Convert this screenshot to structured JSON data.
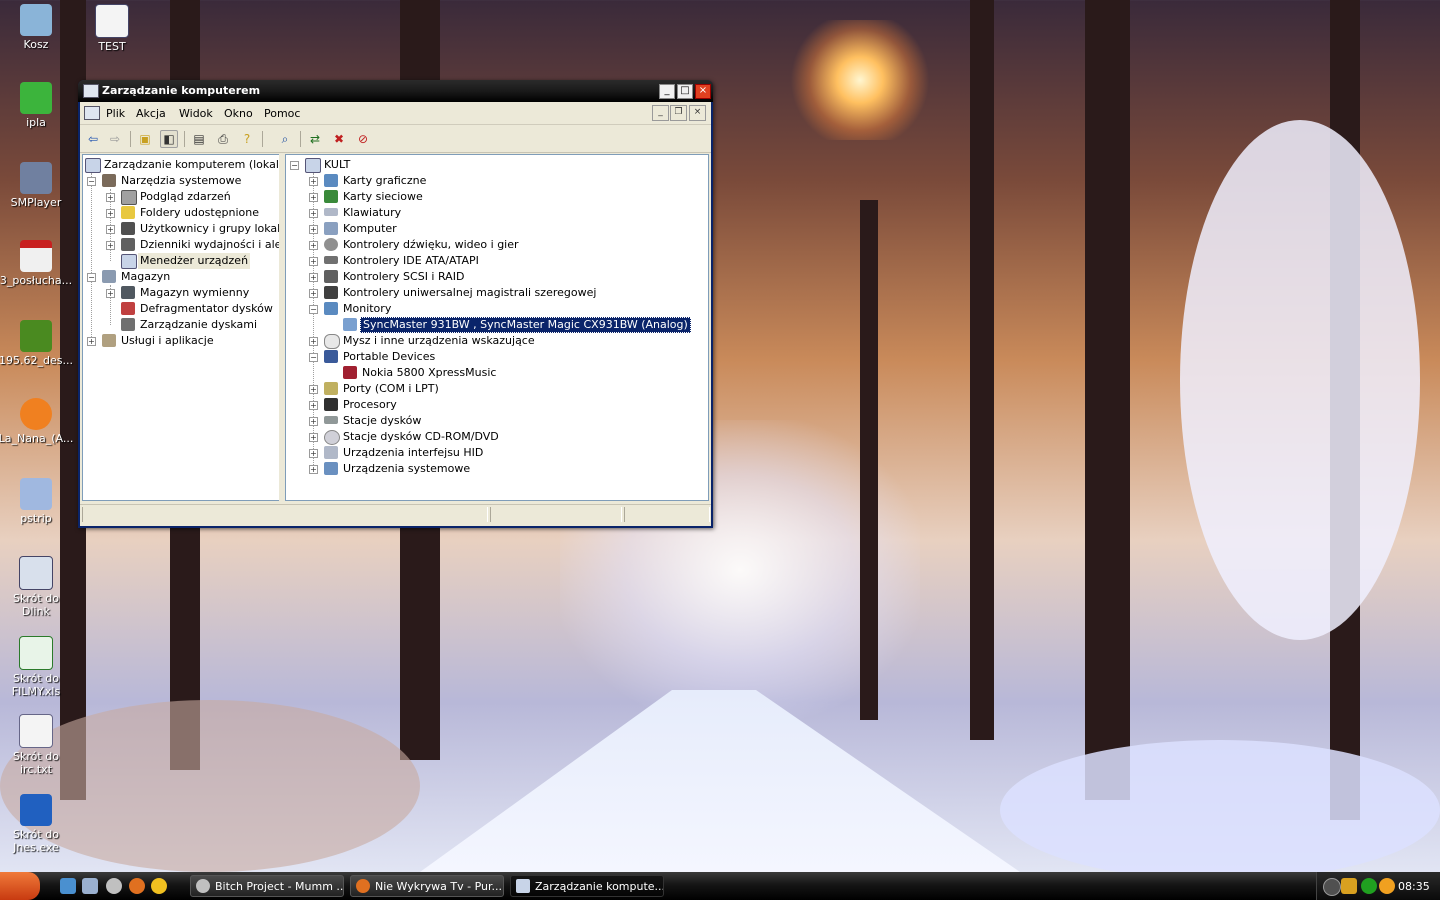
{
  "desktop": {
    "icons": [
      {
        "label": "Kosz",
        "icon": "recycle-bin-icon"
      },
      {
        "label": "TEST",
        "icon": "word-document-icon"
      },
      {
        "label": "ipla",
        "icon": "ipla-icon"
      },
      {
        "label": "SMPlayer",
        "icon": "smplayer-icon"
      },
      {
        "label": "3_posłucha...",
        "icon": "pdf-icon"
      },
      {
        "label": "195.62_des...",
        "icon": "nvidia-icon"
      },
      {
        "label": "La_Nana_(A...",
        "icon": "audio-file-icon"
      },
      {
        "label": "pstrip",
        "icon": "pstrip-icon"
      },
      {
        "label": "Skrót do Dlink",
        "icon": "network-shortcut-icon"
      },
      {
        "label": "Skrót do FILMY.xls",
        "icon": "excel-shortcut-icon"
      },
      {
        "label": "Skrót do irc.txt",
        "icon": "text-shortcut-icon"
      },
      {
        "label": "Skrót do Jnes.exe",
        "icon": "jnes-shortcut-icon"
      }
    ]
  },
  "window": {
    "title": "Zarządzanie komputerem",
    "menu": [
      "Plik",
      "Akcja",
      "Widok",
      "Okno",
      "Pomoc"
    ],
    "title_buttons": {
      "minimize": "_",
      "maximize": "□",
      "close": "×"
    },
    "mdi_buttons": {
      "minimize": "_",
      "restore": "❐",
      "close": "×"
    },
    "toolbar": [
      "back-icon",
      "forward-icon",
      "up-folder-icon",
      "show-hide-tree-icon",
      "properties-icon",
      "print-icon",
      "help-icon",
      "scan-hardware-icon",
      "update-driver-icon",
      "uninstall-icon",
      "disable-icon"
    ],
    "left_tree": [
      {
        "label": "Zarządzanie komputerem (lokalne)",
        "level": 0,
        "expander": "",
        "icon": "computer-management-icon"
      },
      {
        "label": "Narzędzia systemowe",
        "level": 1,
        "expander": "−",
        "icon": "system-tools-icon"
      },
      {
        "label": "Podgląd zdarzeń",
        "level": 2,
        "expander": "+",
        "icon": "event-viewer-icon"
      },
      {
        "label": "Foldery udostępnione",
        "level": 2,
        "expander": "+",
        "icon": "shared-folders-icon"
      },
      {
        "label": "Użytkownicy i grupy lokalne",
        "level": 2,
        "expander": "+",
        "icon": "users-groups-icon"
      },
      {
        "label": "Dzienniki wydajności i alerty",
        "level": 2,
        "expander": "+",
        "icon": "performance-logs-icon"
      },
      {
        "label": "Menedżer urządzeń",
        "level": 2,
        "expander": "",
        "icon": "device-manager-icon",
        "state": "inactive-selected"
      },
      {
        "label": "Magazyn",
        "level": 1,
        "expander": "−",
        "icon": "storage-icon"
      },
      {
        "label": "Magazyn wymienny",
        "level": 2,
        "expander": "+",
        "icon": "removable-storage-icon"
      },
      {
        "label": "Defragmentator dysków",
        "level": 2,
        "expander": "",
        "icon": "defragmenter-icon"
      },
      {
        "label": "Zarządzanie dyskami",
        "level": 2,
        "expander": "",
        "icon": "disk-management-icon"
      },
      {
        "label": "Usługi i aplikacje",
        "level": 1,
        "expander": "+",
        "icon": "services-applications-icon"
      }
    ],
    "right_tree": [
      {
        "label": "KULT",
        "level": 0,
        "expander": "−",
        "icon": "computer-icon"
      },
      {
        "label": "Karty graficzne",
        "level": 1,
        "expander": "+",
        "icon": "display-adapter-icon"
      },
      {
        "label": "Karty sieciowe",
        "level": 1,
        "expander": "+",
        "icon": "network-adapter-icon"
      },
      {
        "label": "Klawiatury",
        "level": 1,
        "expander": "+",
        "icon": "keyboard-icon"
      },
      {
        "label": "Komputer",
        "level": 1,
        "expander": "+",
        "icon": "computer-icon"
      },
      {
        "label": "Kontrolery dźwięku, wideo i gier",
        "level": 1,
        "expander": "+",
        "icon": "sound-controller-icon"
      },
      {
        "label": "Kontrolery IDE ATA/ATAPI",
        "level": 1,
        "expander": "+",
        "icon": "ide-controller-icon"
      },
      {
        "label": "Kontrolery SCSI i RAID",
        "level": 1,
        "expander": "+",
        "icon": "scsi-controller-icon"
      },
      {
        "label": "Kontrolery uniwersalnej magistrali szeregowej",
        "level": 1,
        "expander": "+",
        "icon": "usb-controller-icon"
      },
      {
        "label": "Monitory",
        "level": 1,
        "expander": "−",
        "icon": "monitor-icon"
      },
      {
        "label": "SyncMaster 931BW , SyncMaster Magic CX931BW (Analog)",
        "level": 2,
        "expander": "",
        "icon": "monitor-icon",
        "state": "selected"
      },
      {
        "label": "Mysz i inne urządzenia wskazujące",
        "level": 1,
        "expander": "+",
        "icon": "mouse-icon"
      },
      {
        "label": "Portable Devices",
        "level": 1,
        "expander": "−",
        "icon": "portable-devices-icon"
      },
      {
        "label": "Nokia 5800 XpressMusic",
        "level": 2,
        "expander": "",
        "icon": "phone-icon"
      },
      {
        "label": "Porty (COM i LPT)",
        "level": 1,
        "expander": "+",
        "icon": "port-icon"
      },
      {
        "label": "Procesory",
        "level": 1,
        "expander": "+",
        "icon": "processor-icon"
      },
      {
        "label": "Stacje dysków",
        "level": 1,
        "expander": "+",
        "icon": "disk-drive-icon"
      },
      {
        "label": "Stacje dysków CD-ROM/DVD",
        "level": 1,
        "expander": "+",
        "icon": "cdrom-icon"
      },
      {
        "label": "Urządzenia interfejsu HID",
        "level": 1,
        "expander": "+",
        "icon": "hid-icon"
      },
      {
        "label": "Urządzenia systemowe",
        "level": 1,
        "expander": "+",
        "icon": "system-devices-icon"
      }
    ]
  },
  "taskbar": {
    "quick_launch": [
      "show-desktop-icon",
      "my-computer-icon",
      "alien-icon",
      "firefox-icon",
      "smiley-icon"
    ],
    "tasks": [
      {
        "label": "Bitch Project - Mumm ...",
        "icon": "alien-icon",
        "active": false
      },
      {
        "label": "Nie Wykrywa Tv - Pur...",
        "icon": "firefox-icon",
        "active": false
      },
      {
        "label": "Zarządzanie kompute...",
        "icon": "computer-management-icon",
        "active": true
      }
    ],
    "tray": [
      "arrow-left-icon",
      "kaspersky-icon",
      "gg-icon",
      "sun-icon"
    ],
    "clock": "08:35"
  },
  "colors": {
    "selection": "#0a246a",
    "window_face": "#ece9d8",
    "titlebar": "#1a1a1a",
    "start_button": "#e05a20"
  }
}
